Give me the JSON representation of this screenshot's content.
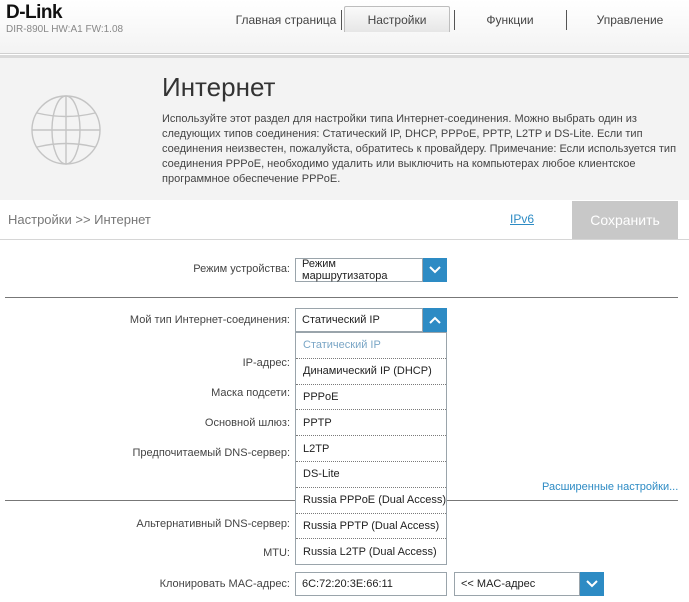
{
  "brand": {
    "logo": "D-Link",
    "model_info": "DIR-890L   HW:A1   FW:1.08"
  },
  "nav": {
    "home": "Главная страница",
    "settings": "Настройки",
    "features": "Функции",
    "management": "Управление"
  },
  "hero": {
    "title": "Интернет",
    "description": "Используйте этот раздел для настройки типа Интернет-соединения. Можно выбрать один из следующих типов соединения: Статический IP, DHCP, PPPoE, PPTP, L2TP и DS-Lite. Если тип соединения неизвестен, пожалуйста, обратитесь к провайдеру. Примечание: Если используется тип соединения PPPoE, необходимо удалить или выключить на компьютерах любое клиентское программное обеспечение PPPoE."
  },
  "toolbar": {
    "breadcrumb": "Настройки >> Интернет",
    "ipv6_link": "IPv6",
    "save_label": "Сохранить"
  },
  "form": {
    "device_mode_label": "Режим устройства:",
    "device_mode_value": "Режим маршрутизатора",
    "conn_type_label": "Мой тип Интернет-соединения:",
    "conn_type_value": "Статический IP",
    "ip_label": "IP-адрес:",
    "mask_label": "Маска подсети:",
    "gateway_label": "Основной шлюз:",
    "dns1_label": "Предпочитаемый DNS-сервер:",
    "advanced_link": "Расширенные настройки...",
    "dns2_label": "Альтернативный DNS-сервер:",
    "mtu_label": "MTU:",
    "mac_label": "Клонировать MAC-адрес:",
    "mac_value": "6C:72:20:3E:66:11",
    "mac_select_value": "<< MAC-адрес"
  },
  "dropdown_options": [
    "Статический IP",
    "Динамический IP (DHCP)",
    "PPPoE",
    "PPTP",
    "L2TP",
    "DS-Lite",
    "Russia PPPoE (Dual Access)",
    "Russia PPTP (Dual Access)",
    "Russia L2TP (Dual Access)"
  ],
  "colors": {
    "accent": "#2d8bc4",
    "save_disabled": "#c8c8c8",
    "hero_bg": "#f3f3f3"
  }
}
